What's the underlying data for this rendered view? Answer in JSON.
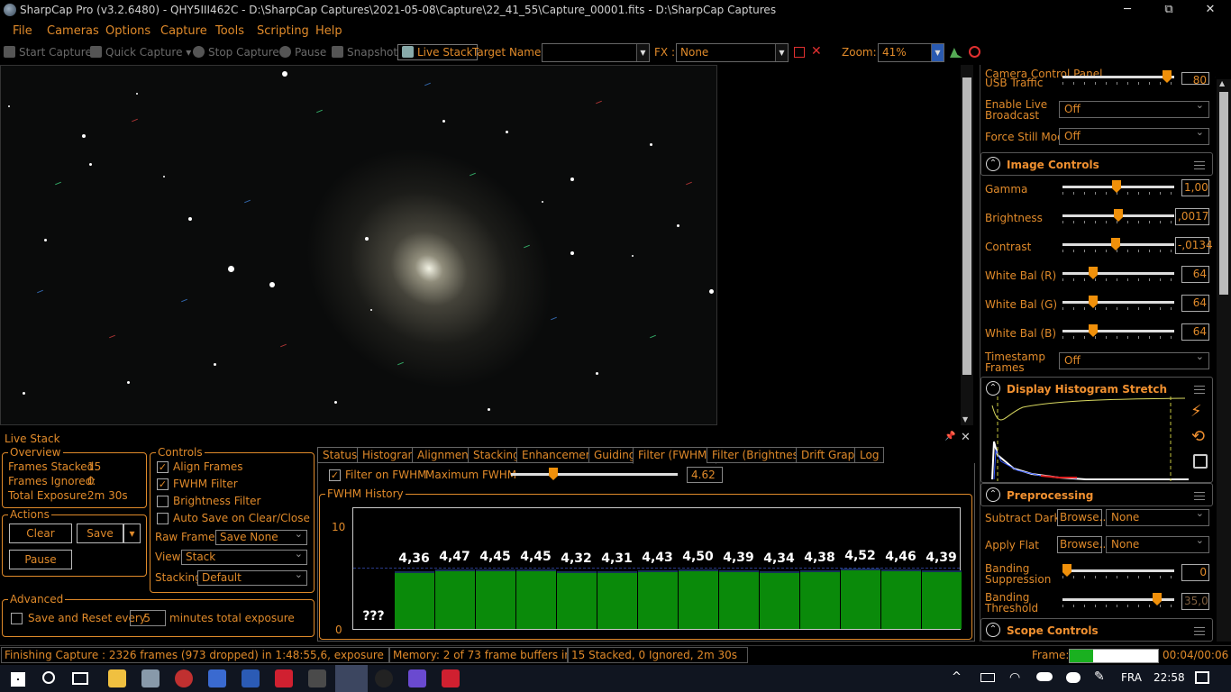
{
  "window": {
    "title": "SharpCap Pro (v3.2.6480) - QHY5III462C - D:\\SharpCap Captures\\2021-05-08\\Capture\\22_41_55\\Capture_00001.fits - D:\\SharpCap Captures",
    "minimize": "─",
    "maximize": "⧉",
    "close": "✕"
  },
  "menu": [
    "File",
    "Cameras",
    "Options",
    "Capture",
    "Tools",
    "Scripting",
    "Help"
  ],
  "toolbar": {
    "start_capture": "Start Capture",
    "quick_capture": "Quick Capture",
    "stop_capture": "Stop Capture",
    "pause": "Pause",
    "snapshot": "Snapshot",
    "live_stack": "Live Stack",
    "target_label": "Target Name :",
    "target_value": "",
    "fx_label": "FX :",
    "fx_value": "None",
    "zoom_label": "Zoom:",
    "zoom_value": "41%"
  },
  "camera_panel": {
    "title": "Camera Control Panel",
    "usb_traffic_label": "USB Traffic",
    "usb_traffic_value": "80",
    "usb_traffic_level": 0.97,
    "enable_live_broadcast_label": "Enable Live Broadcast",
    "enable_live_broadcast_value": "Off",
    "force_still_label": "Force Still Mode",
    "force_still_value": "Off",
    "image_controls": {
      "title": "Image Controls",
      "controls": [
        {
          "label": "Gamma",
          "value": "1,00",
          "level": 0.48
        },
        {
          "label": "Brightness",
          "value": ",0017",
          "level": 0.5
        },
        {
          "label": "Contrast",
          "value": "-,0134",
          "level": 0.47
        },
        {
          "label": "White Bal (R)",
          "value": "64",
          "level": 0.25
        },
        {
          "label": "White Bal (G)",
          "value": "64",
          "level": 0.25
        },
        {
          "label": "White Bal (B)",
          "value": "64",
          "level": 0.25
        }
      ],
      "timestamp_label": "Timestamp Frames",
      "timestamp_value": "Off"
    },
    "histogram_title": "Display Histogram Stretch",
    "preprocessing": {
      "title": "Preprocessing",
      "subtract_dark_label": "Subtract Dark",
      "browse_label": "Browse...",
      "subtract_dark_value": "None",
      "apply_flat_label": "Apply Flat",
      "apply_flat_value": "None",
      "banding_suppression_label": "Banding Suppression",
      "banding_suppression_value": "0",
      "banding_suppression_level": 0.0,
      "banding_threshold_label": "Banding Threshold",
      "banding_threshold_value": "35,0",
      "banding_threshold_level": 0.88
    },
    "scope_controls_title": "Scope Controls"
  },
  "live_stack": {
    "title": "Live Stack",
    "pin": "📌",
    "close": "✕",
    "overview": {
      "title": "Overview",
      "frames_stacked_label": "Frames Stacked:",
      "frames_stacked": "15",
      "frames_ignored_label": "Frames Ignored:",
      "frames_ignored": "0",
      "total_exposure_label": "Total Exposure:",
      "total_exposure": "2m 30s"
    },
    "actions": {
      "title": "Actions",
      "clear": "Clear",
      "save": "Save",
      "pause": "Pause"
    },
    "advanced": {
      "title": "Advanced",
      "save_reset_label": "Save and Reset every",
      "minutes": "5",
      "minutes_suffix": "minutes total exposure"
    },
    "controls": {
      "title": "Controls",
      "align_frames": "Align Frames",
      "fwhm_filter": "FWHM Filter",
      "brightness_filter": "Brightness Filter",
      "auto_save": "Auto Save on Clear/Close",
      "raw_frames_label": "Raw Frames",
      "raw_frames_value": "Save None",
      "view_label": "View",
      "view_value": "Stack",
      "stacking_label": "Stacking",
      "stacking_value": "Default"
    },
    "tabs": [
      "Status",
      "Histogram",
      "Alignment",
      "Stacking",
      "Enhancement",
      "Guiding",
      "Filter (FWHM)",
      "Filter (Brightness)",
      "Drift Graph",
      "Log"
    ],
    "active_tab": "Filter (FWHM)",
    "filter_on_fwhm": "Filter on FWHM",
    "max_fwhm_label": "Maximum FWHM",
    "max_fwhm_value": "4.62",
    "max_fwhm_level": 0.24,
    "history_title": "FWHM History"
  },
  "chart_data": {
    "type": "bar",
    "title": "FWHM History",
    "ylim": [
      0,
      10
    ],
    "yticks": [
      "10",
      "0"
    ],
    "categories": [
      "1",
      "2",
      "3",
      "4",
      "5",
      "6",
      "7",
      "8",
      "9",
      "10",
      "11",
      "12",
      "13",
      "14",
      "15"
    ],
    "labels": [
      "???",
      "4,36",
      "4,47",
      "4,45",
      "4,45",
      "4,32",
      "4,31",
      "4,43",
      "4,50",
      "4,39",
      "4,34",
      "4,38",
      "4,52",
      "4,46",
      "4,39"
    ],
    "values": [
      null,
      4.36,
      4.47,
      4.45,
      4.45,
      4.32,
      4.31,
      4.43,
      4.5,
      4.39,
      4.34,
      4.38,
      4.52,
      4.46,
      4.39
    ]
  },
  "status": {
    "finishing": "Finishing Capture : 2326 frames (973 dropped) in 1:48:55,6, exposure 10,0s , last frame",
    "memory": "Memory: 2 of 73 frame buffers in use",
    "stack": "15 Stacked, 0 Ignored, 2m 30s",
    "frame_label": "Frame:",
    "frame_progress": 0.27,
    "frame_time": "00:04/00:06"
  },
  "taskbar": {
    "language": "FRA",
    "time": "22:58"
  }
}
